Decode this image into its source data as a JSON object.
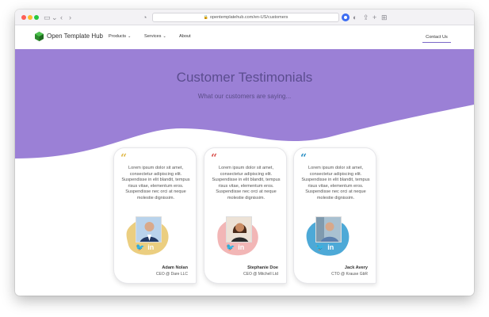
{
  "browser": {
    "url": "opentemplatehub.com/en-US/customers"
  },
  "nav": {
    "brand": "Open Template Hub",
    "items": [
      {
        "label": "Products"
      },
      {
        "label": "Services"
      },
      {
        "label": "About"
      }
    ],
    "contact_label": "Contact Us"
  },
  "hero": {
    "title": "Customer Testimonials",
    "subtitle": "What our customers are saying..."
  },
  "colors": {
    "hero_purple": "#9b80d6",
    "card1_accent": "#e8c56a",
    "card2_accent": "#f0a9a9",
    "card3_accent": "#2e9ad0"
  },
  "testimonials": [
    {
      "quote_mark": "“",
      "text": "Lorem ipsum dolor sit amet, consectetur adipiscing elit. Suspendisse in elit blandit, tempus risus vitae, elementum eros. Suspendisse nec orci at neque molestie dignissim.",
      "name": "Adam Nolan",
      "role": "CEO @ Dare LLC",
      "icons": [
        "twitter-icon",
        "linkedin-icon"
      ]
    },
    {
      "quote_mark": "“",
      "text": "Lorem ipsum dolor sit amet, consectetur adipiscing elit. Suspendisse in elit blandit, tempus risus vitae, elementum eros. Suspendisse nec orci at neque molestie dignissim.",
      "name": "Stephanie Doe",
      "role": "CEO @ Mitchell Ltd",
      "icons": [
        "twitter-icon",
        "linkedin-icon"
      ]
    },
    {
      "quote_mark": "“",
      "text": "Lorem ipsum dolor sit amet, consectetur adipiscing elit. Suspendisse in elit blandit, tempus risus vitae, elementum eros. Suspendisse nec orci at neque molestie dignissim.",
      "name": "Jack Avery",
      "role": "CTO @ Krause GbR",
      "icons": [
        "twitter-icon",
        "linkedin-icon"
      ]
    }
  ]
}
